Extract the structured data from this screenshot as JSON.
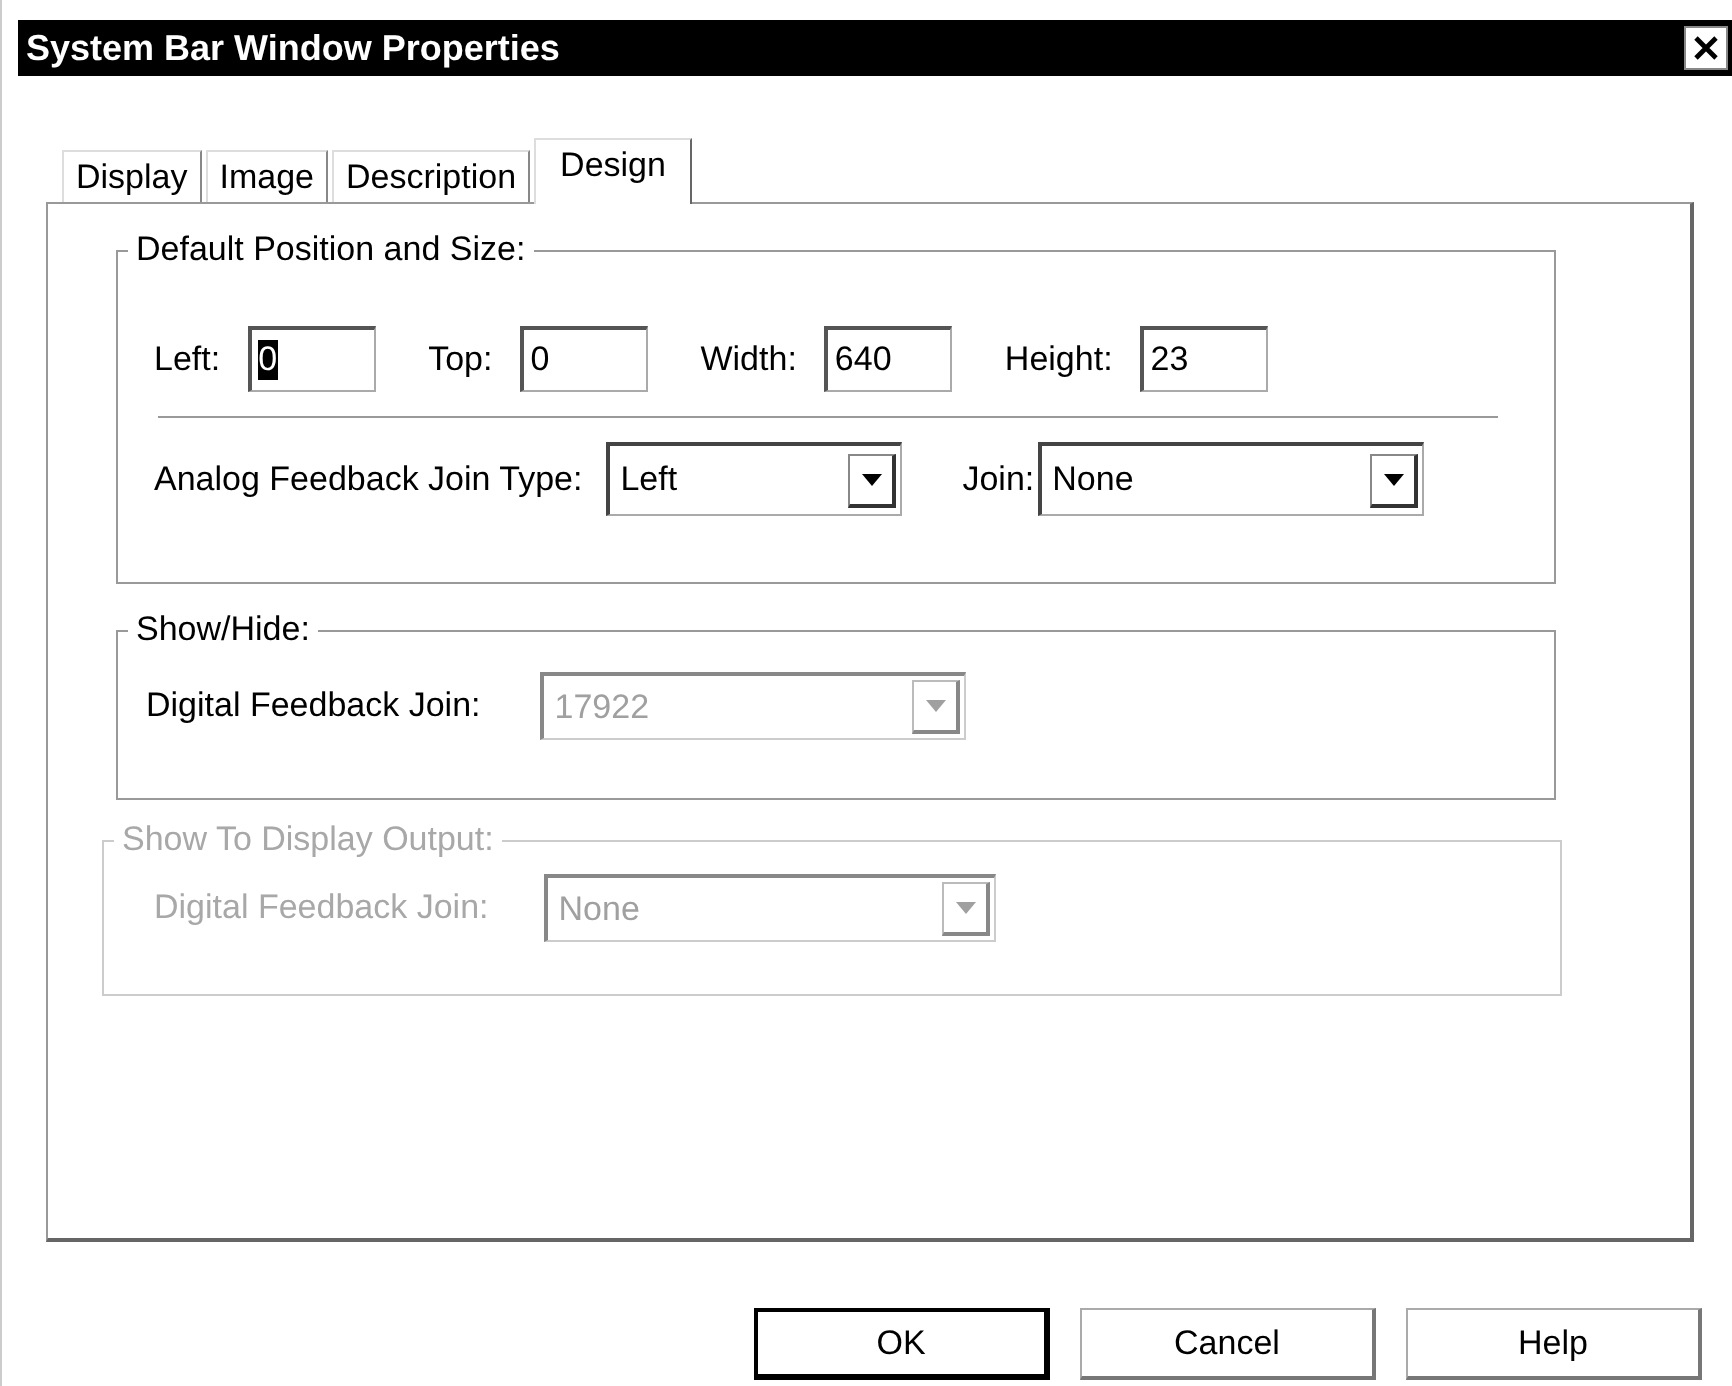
{
  "window": {
    "title": "System Bar Window Properties"
  },
  "tabs": [
    {
      "label": "Display",
      "selected": false
    },
    {
      "label": "Image",
      "selected": false
    },
    {
      "label": "Description",
      "selected": false
    },
    {
      "label": "Design",
      "selected": true
    }
  ],
  "groups": [
    {
      "title": "Default Position and Size:",
      "disabled": false,
      "size_fields": [
        {
          "label": "Left:",
          "value": "0",
          "selected": true
        },
        {
          "label": "Top:",
          "value": "0",
          "selected": false
        },
        {
          "label": "Width:",
          "value": "640",
          "selected": false
        },
        {
          "label": "Height:",
          "value": "23",
          "selected": false
        }
      ],
      "join_fields": [
        {
          "label": "Analog Feedback Join Type:",
          "value": "Left",
          "disabled": false
        },
        {
          "label": "Join:",
          "value": "None",
          "disabled": false
        }
      ]
    },
    {
      "title": "Show/Hide:",
      "disabled": false,
      "join_fields": [
        {
          "label": "Digital Feedback Join:",
          "value": "17922",
          "disabled": true
        }
      ]
    },
    {
      "title": "Show To Display Output:",
      "disabled": true,
      "join_fields": [
        {
          "label": "Digital Feedback Join:",
          "value": "None",
          "disabled": true
        }
      ]
    }
  ],
  "buttons": [
    {
      "label": "OK",
      "default": true
    },
    {
      "label": "Cancel",
      "default": false
    },
    {
      "label": "Help",
      "default": false
    }
  ]
}
